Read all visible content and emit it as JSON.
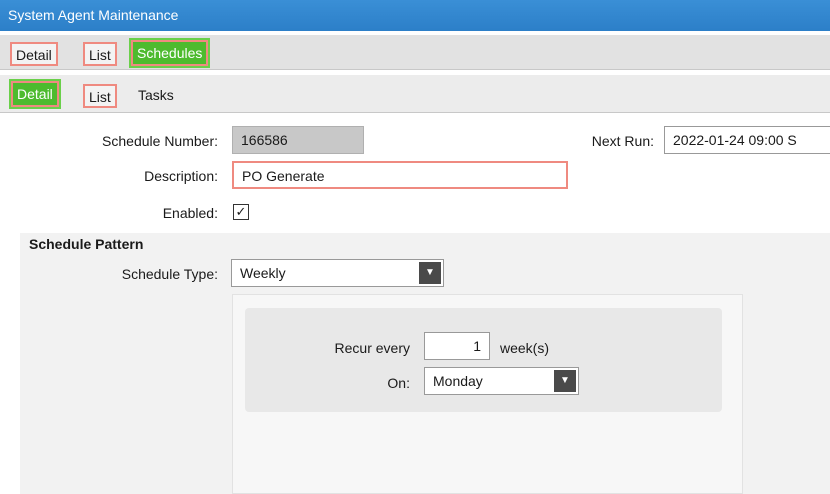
{
  "window": {
    "title": "System Agent Maintenance"
  },
  "tabs_top": [
    {
      "label": "Detail"
    },
    {
      "label": "List"
    },
    {
      "label": "Schedules"
    }
  ],
  "tabs_sub": [
    {
      "label": "Detail"
    },
    {
      "label": "List"
    },
    {
      "label": "Tasks"
    }
  ],
  "form": {
    "schedule_number_label": "Schedule Number:",
    "schedule_number_value": "166586",
    "next_run_label": "Next Run:",
    "next_run_value": "2022-01-24 09:00 S",
    "description_label": "Description:",
    "description_value": "PO Generate",
    "enabled_label": "Enabled:",
    "enabled_checked": true,
    "enabled_mark": "✓"
  },
  "pattern": {
    "section_title": "Schedule Pattern",
    "type_label": "Schedule Type:",
    "type_value": "Weekly",
    "recur_label": "Recur every",
    "recur_value": "1",
    "recur_unit": "week(s)",
    "on_label": "On:",
    "on_value": "Monday"
  },
  "icons": {
    "dropdown": "chevron-down-icon",
    "check": "checkmark-icon"
  },
  "colors": {
    "active_tab": "#4dbb2e",
    "highlight_border": "#ef8a80",
    "titlebar": "#2c7fc8"
  }
}
